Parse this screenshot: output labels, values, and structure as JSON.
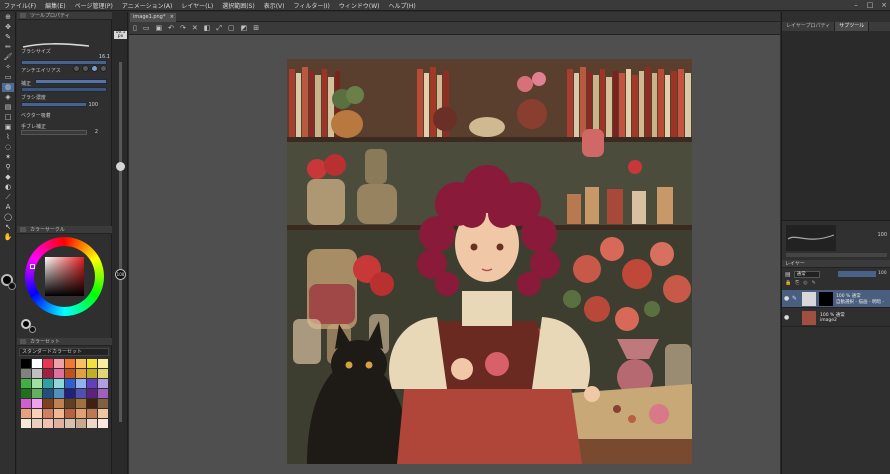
{
  "menubar": {
    "items": [
      "ファイル(F)",
      "編集(E)",
      "ページ管理(P)",
      "アニメーション(A)",
      "レイヤー(L)",
      "選択範囲(S)",
      "表示(V)",
      "フィルター(I)",
      "ウィンドウ(W)",
      "ヘルプ(H)"
    ]
  },
  "tool_property": {
    "tab_label": "ツールプロパティ",
    "brush_size_label": "ブラシサイズ",
    "brush_size_value": "16.1",
    "antialias_label": "アンチエイリアス",
    "thickness_label": "補正",
    "density_label": "ブラシ濃度",
    "density_value": "100",
    "vector_label": "ベクター吸着",
    "stabilization_label": "手ブレ補正",
    "stabilization_value": "2"
  },
  "brush_size_slider": {
    "value": "16.1",
    "sub": "px",
    "level": "100"
  },
  "color_wheel": {
    "tab_label": "カラーサークル",
    "current_color": "#000000"
  },
  "color_set": {
    "tab_label": "カラーセット",
    "set_name": "スタンダードカラーセット",
    "swatches": [
      "#000000",
      "#ffffff",
      "#e8384f",
      "#f0a0a8",
      "#f07830",
      "#f8c060",
      "#f0e040",
      "#f8f0a0",
      "#808080",
      "#c0c0c0",
      "#a02040",
      "#e070a0",
      "#c05020",
      "#e0a040",
      "#c0b020",
      "#e0d870",
      "#40b040",
      "#a0e0a0",
      "#30a0a0",
      "#90d8d8",
      "#3060d0",
      "#90b0f0",
      "#6040c0",
      "#b0a0e0",
      "#207020",
      "#60b060",
      "#205080",
      "#5090c0",
      "#202080",
      "#5050b0",
      "#602080",
      "#a060c0",
      "#d060d0",
      "#f0a0f0",
      "#804020",
      "#c08050",
      "#604020",
      "#a07040",
      "#402010",
      "#806040",
      "#e8a080",
      "#f8d0b8",
      "#d08060",
      "#f0b890",
      "#b86040",
      "#e0a070",
      "#c07850",
      "#f0c8a0",
      "#f8e8d8",
      "#e8d0c0",
      "#f0c0b0",
      "#e0b0a0",
      "#d8c0b0",
      "#c8a890",
      "#f0d8c8",
      "#ffe8e0"
    ]
  },
  "canvas": {
    "tab_label": "image1.png*",
    "close_label": "×"
  },
  "right_panel": {
    "tabs": [
      "レイヤープロパティ",
      "サブツール"
    ]
  },
  "navigator": {
    "zoom": "100"
  },
  "layers": {
    "tab_label": "レイヤー",
    "mode": "通常",
    "opacity": "100",
    "rows": [
      {
        "line1": "100 % 通常",
        "line2": "自動選択 - 描画 - 明暗 -"
      },
      {
        "line1": "100 % 通常",
        "line2": "image2"
      }
    ]
  }
}
